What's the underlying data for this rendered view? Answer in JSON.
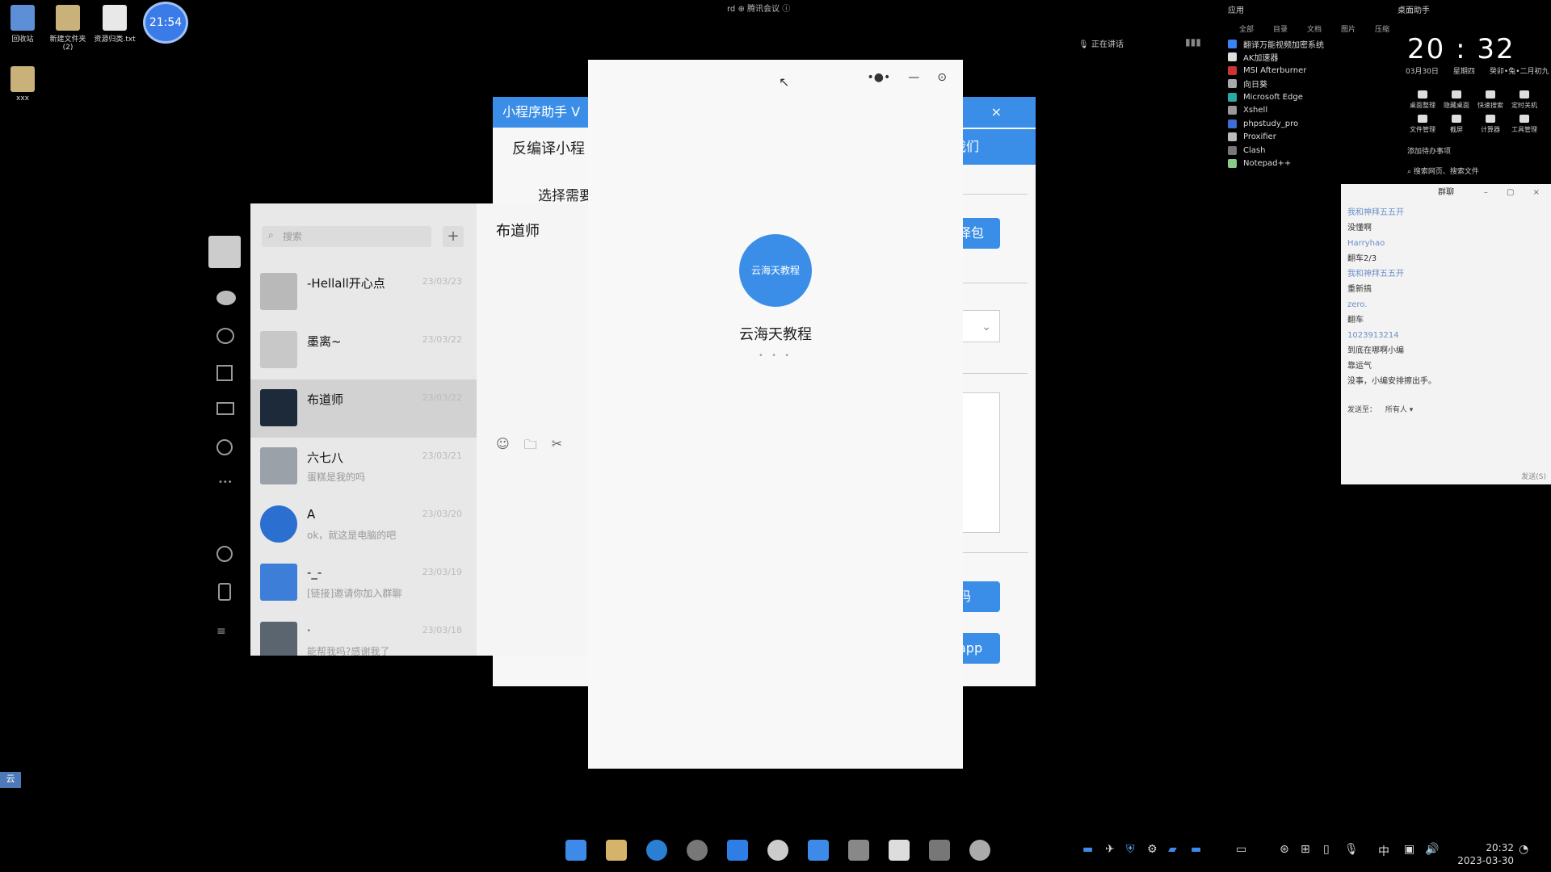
{
  "desktop": {
    "icons": [
      {
        "label": "回收站",
        "icon": "recycle-bin-icon"
      },
      {
        "label": "新建文件夹\n(2)",
        "icon": "folder-icon"
      },
      {
        "label": "资源归类.txt",
        "icon": "text-file-icon"
      },
      {
        "label": "xxx",
        "icon": "folder-icon"
      }
    ],
    "clock_bubble": "21:54",
    "top_center": "rd ⊕ 腾讯会议 ⓘ",
    "status_text": "正在讲话",
    "left_tag": "云"
  },
  "apps_panel": {
    "header": "应用",
    "tabs": [
      "全部",
      "目录",
      "文档",
      "图片",
      "压缩"
    ],
    "items": [
      "翻译万能视频加密系统",
      "AK加速器",
      "MSI Afterburner",
      "向日葵",
      "Microsoft Edge",
      "Xshell",
      "phpstudy_pro",
      "Proxifier",
      "Clash",
      "Notepad++"
    ]
  },
  "clock_panel": {
    "header": "桌面助手",
    "time": "20 : 32",
    "date": "03月30日",
    "weekday": "星期四",
    "lunar": "癸卯•兔•二月初九",
    "actions_row1": [
      "桌面整理",
      "隐藏桌面",
      "快速搜索",
      "定时关机"
    ],
    "actions_row2": [
      "文件管理",
      "截屏",
      "计算器",
      "工具管理"
    ],
    "tip": "添加待办事项",
    "search_hint": "搜索网页、搜索文件"
  },
  "group_chat": {
    "title": "群聊",
    "messages": [
      {
        "name": "我和神拜五五开",
        "text": "没懂啊"
      },
      {
        "name": "Harryhao",
        "text": "翻车2/3"
      },
      {
        "name": "我和神拜五五开",
        "text": "重新搞"
      },
      {
        "name": "zero.",
        "text": "翻车"
      },
      {
        "name": "1023913214",
        "text": "到底在哪啊小编"
      },
      {
        "name": "",
        "text": "靠运气"
      },
      {
        "name": "",
        "text": "没事，小编安排擦出手。"
      }
    ],
    "send_to_label": "发送至：",
    "send_to_value": "所有人",
    "send_button": "发送(S)"
  },
  "tool_window": {
    "title": "小程序助手 V",
    "heading": "反编译小程",
    "subheading": "选择需要",
    "button_top": "我们",
    "button_select": "译包",
    "button_code": "码",
    "button_app": "app"
  },
  "wechat": {
    "search_placeholder": "搜索",
    "plus": "+",
    "contacts": [
      {
        "name": "-Hellall开心点",
        "preview": "",
        "time": "23/03/23"
      },
      {
        "name": "墨离~",
        "preview": "",
        "time": "23/03/22"
      },
      {
        "name": "布道师",
        "preview": "",
        "time": "23/03/22"
      },
      {
        "name": "六七八",
        "preview": "蛋糕是我的吗",
        "time": "23/03/21"
      },
      {
        "name": "A",
        "preview": "ok，就这是电脑的吧",
        "time": "23/03/20"
      },
      {
        "name": "-_-",
        "preview": "[链接]邀请你加入群聊",
        "time": "23/03/19"
      },
      {
        "name": "·",
        "preview": "能帮我吗?感谢我了",
        "time": "23/03/18"
      }
    ],
    "active_chat": "布道师"
  },
  "mini_program": {
    "logo_text": "云海天教程",
    "name": "云海天教程",
    "loading": "• • •"
  },
  "taskbar": {
    "time": "20:32",
    "date": "2023-03-30",
    "ime": "中"
  },
  "colors": {
    "accent": "#3b8ee8",
    "clock_bubble": "#3a7be8"
  }
}
